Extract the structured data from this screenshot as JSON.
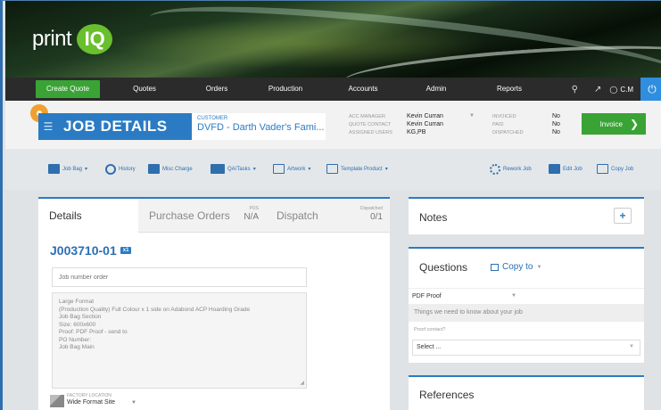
{
  "brand": {
    "name": "print",
    "badge": "IQ"
  },
  "nav": {
    "create": "Create Quote",
    "items": [
      "Quotes",
      "Orders",
      "Production",
      "Accounts",
      "Admin",
      "Reports"
    ],
    "user": "C.M"
  },
  "header": {
    "title": "JOB DETAILS",
    "customer_label": "CUSTOMER",
    "customer_value": "DVFD - Darth Vader's Fami...",
    "acc_labels": [
      "ACC MANAGER",
      "QUOTE CONTACT",
      "ASSIGNED USERS"
    ],
    "acc_values": [
      "Kevin Curran",
      "Kevin Curran",
      "KG,PB"
    ],
    "inv_labels": [
      "INVOICED",
      "PAID",
      "DISPATCHED"
    ],
    "inv_values": [
      "No",
      "No",
      "No"
    ],
    "invoice_label": "Invoice"
  },
  "toolbar": {
    "job_bag": "Job Bag",
    "history": "History",
    "misc_charge": "Misc Charge",
    "qa_tasks": "QA/Tasks",
    "artwork": "Artwork",
    "template_product": "Template Product",
    "rework_job": "Rework Job",
    "edit_job": "Edit Job",
    "copy_job": "Copy Job"
  },
  "tabs": {
    "details": "Details",
    "purchase_orders": "Purchase Orders",
    "pos_label": "POS",
    "pos_value": "N/A",
    "dispatch": "Dispatch",
    "dispatched_label": "Dispatched",
    "dispatched_value": "0/1"
  },
  "job": {
    "number": "J003710-01",
    "qty_badge": "x1",
    "name_placeholder": "Job number order",
    "description_lines": [
      "Large Format",
      " (Production Quality) Full Colour x 1 side  on Adabond ACP Hoarding Grade",
      "Job Bag Section",
      "Size: 600x600",
      "Proof: PDF Proof - send to",
      "PO Number:",
      "Job Bag Main"
    ],
    "factory_label": "FACTORY LOCATION",
    "factory_value": "Wide Format Site"
  },
  "notes": {
    "title": "Notes"
  },
  "questions": {
    "title": "Questions",
    "copy_to": "Copy to",
    "proof_select": "PDF Proof",
    "info_text": "Things we need to know about your job",
    "proof_contact_label": "Proof contact?",
    "proof_contact_value": "Select ..."
  },
  "references": {
    "title": "References"
  }
}
